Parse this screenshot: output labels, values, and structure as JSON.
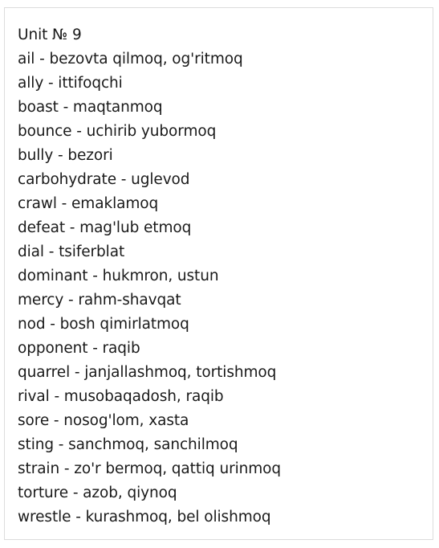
{
  "title": "Unit № 9",
  "entries": [
    "ail - bezovta qilmoq, og'ritmoq",
    "ally - ittifoqchi",
    "boast - maqtanmoq",
    "bounce - uchirib yubormoq",
    "bully - bezori",
    "carbohydrate - uglevod",
    "crawl - emaklamoq",
    "defeat - mag'lub etmoq",
    "dial - tsiferblat",
    "dominant - hukmron, ustun",
    "mercy - rahm-shavqat",
    "nod - bosh qimirlatmoq",
    "opponent - raqib",
    "quarrel - janjallashmoq, tortishmoq",
    "rival - musobaqadosh, raqib",
    "sore - nosog'lom, xasta",
    "sting - sanchmoq, sanchilmoq",
    "strain - zo'r bermoq, qattiq urinmoq",
    "torture - azob, qiynoq",
    "wrestle - kurashmoq, bel olishmoq"
  ]
}
